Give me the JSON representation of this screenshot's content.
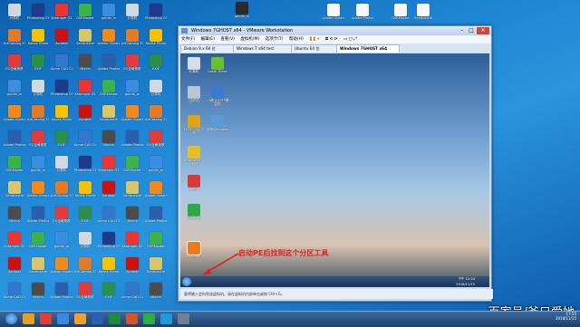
{
  "desktop": {
    "icons": [
      {
        "label": "计算机",
        "color": "#cfd8e3"
      },
      {
        "label": "ArtCatalog 33.7",
        "color": "#e07b2a"
      },
      {
        "label": "EC全局换肤",
        "color": "#e23b3b"
      },
      {
        "label": "goldie_m",
        "color": "#3a8de0"
      },
      {
        "label": "Adobe Illustrator",
        "color": "#f08a1c"
      },
      {
        "label": "Adobe Photoshop",
        "color": "#2a5fae"
      },
      {
        "label": "GSRMoster",
        "color": "#3bb34a"
      },
      {
        "label": "Sandcastle",
        "color": "#d8c66a"
      },
      {
        "label": "Mixins",
        "color": "#4c4c4c"
      },
      {
        "label": "Kstamper 32",
        "color": "#e33"
      },
      {
        "label": "Acrobat",
        "color": "#c11"
      },
      {
        "label": "Acme CAD Converter",
        "color": "#3377cc"
      },
      {
        "label": "Photoshop CS6",
        "color": "#1e3a8a"
      },
      {
        "label": "Kodak Photo",
        "color": "#f5c400"
      },
      {
        "label": "EXIF",
        "color": "#2a8f4a"
      }
    ],
    "watermark": "百家号/爷只爱她",
    "taskbar_apps": [
      "start",
      "explorer",
      "chrome",
      "ie",
      "media",
      "word",
      "excel",
      "ppt",
      "wechat",
      "qq",
      "vmware"
    ],
    "clock": {
      "time": "17:55",
      "date": "2018/11/15"
    }
  },
  "vmware": {
    "title": "Windows 7GHOST x64 - VMware Workstation",
    "menu": [
      "文件(F)",
      "编辑(E)",
      "查看(V)",
      "虚拟机(M)",
      "选项卡(T)",
      "帮助(H)"
    ],
    "tabs": [
      {
        "label": "Debian 9.x 64 位",
        "active": false
      },
      {
        "label": "Windows 7 x64 test",
        "active": false
      },
      {
        "label": "Ubuntu 64 位",
        "active": false
      },
      {
        "label": "Windows 7GHOST x64",
        "active": true
      }
    ],
    "status": "要将输入定向到该虚拟机，请在虚拟机内部单击或按 Ctrl+G。"
  },
  "guest": {
    "icons": [
      {
        "label": "计算机",
        "color": "#d7dde6"
      },
      {
        "label": "Local Drive",
        "color": "#6cbe2a"
      },
      {
        "label": "回收站",
        "color": "#b8c7d6"
      },
      {
        "label": "一键GHOST硬盘版",
        "color": "#3a7bd0"
      },
      {
        "label": "TXTW 分区大师",
        "color": "#e1a21a"
      },
      {
        "label": "安装Windows",
        "color": "#5b9bd5"
      },
      {
        "label": "Windows密码修改",
        "color": "#e6c02a"
      },
      {
        "label": "修改器",
        "color": "#d63a3a"
      },
      {
        "label": "分区助手",
        "color": "#2aa84a"
      },
      {
        "label": "DiskGenius",
        "color": "#f07a1a"
      }
    ],
    "annotation": "启动PE后找到这个分区工具",
    "clock": {
      "time": "下午 12:24",
      "date": "2018/11/15"
    }
  }
}
